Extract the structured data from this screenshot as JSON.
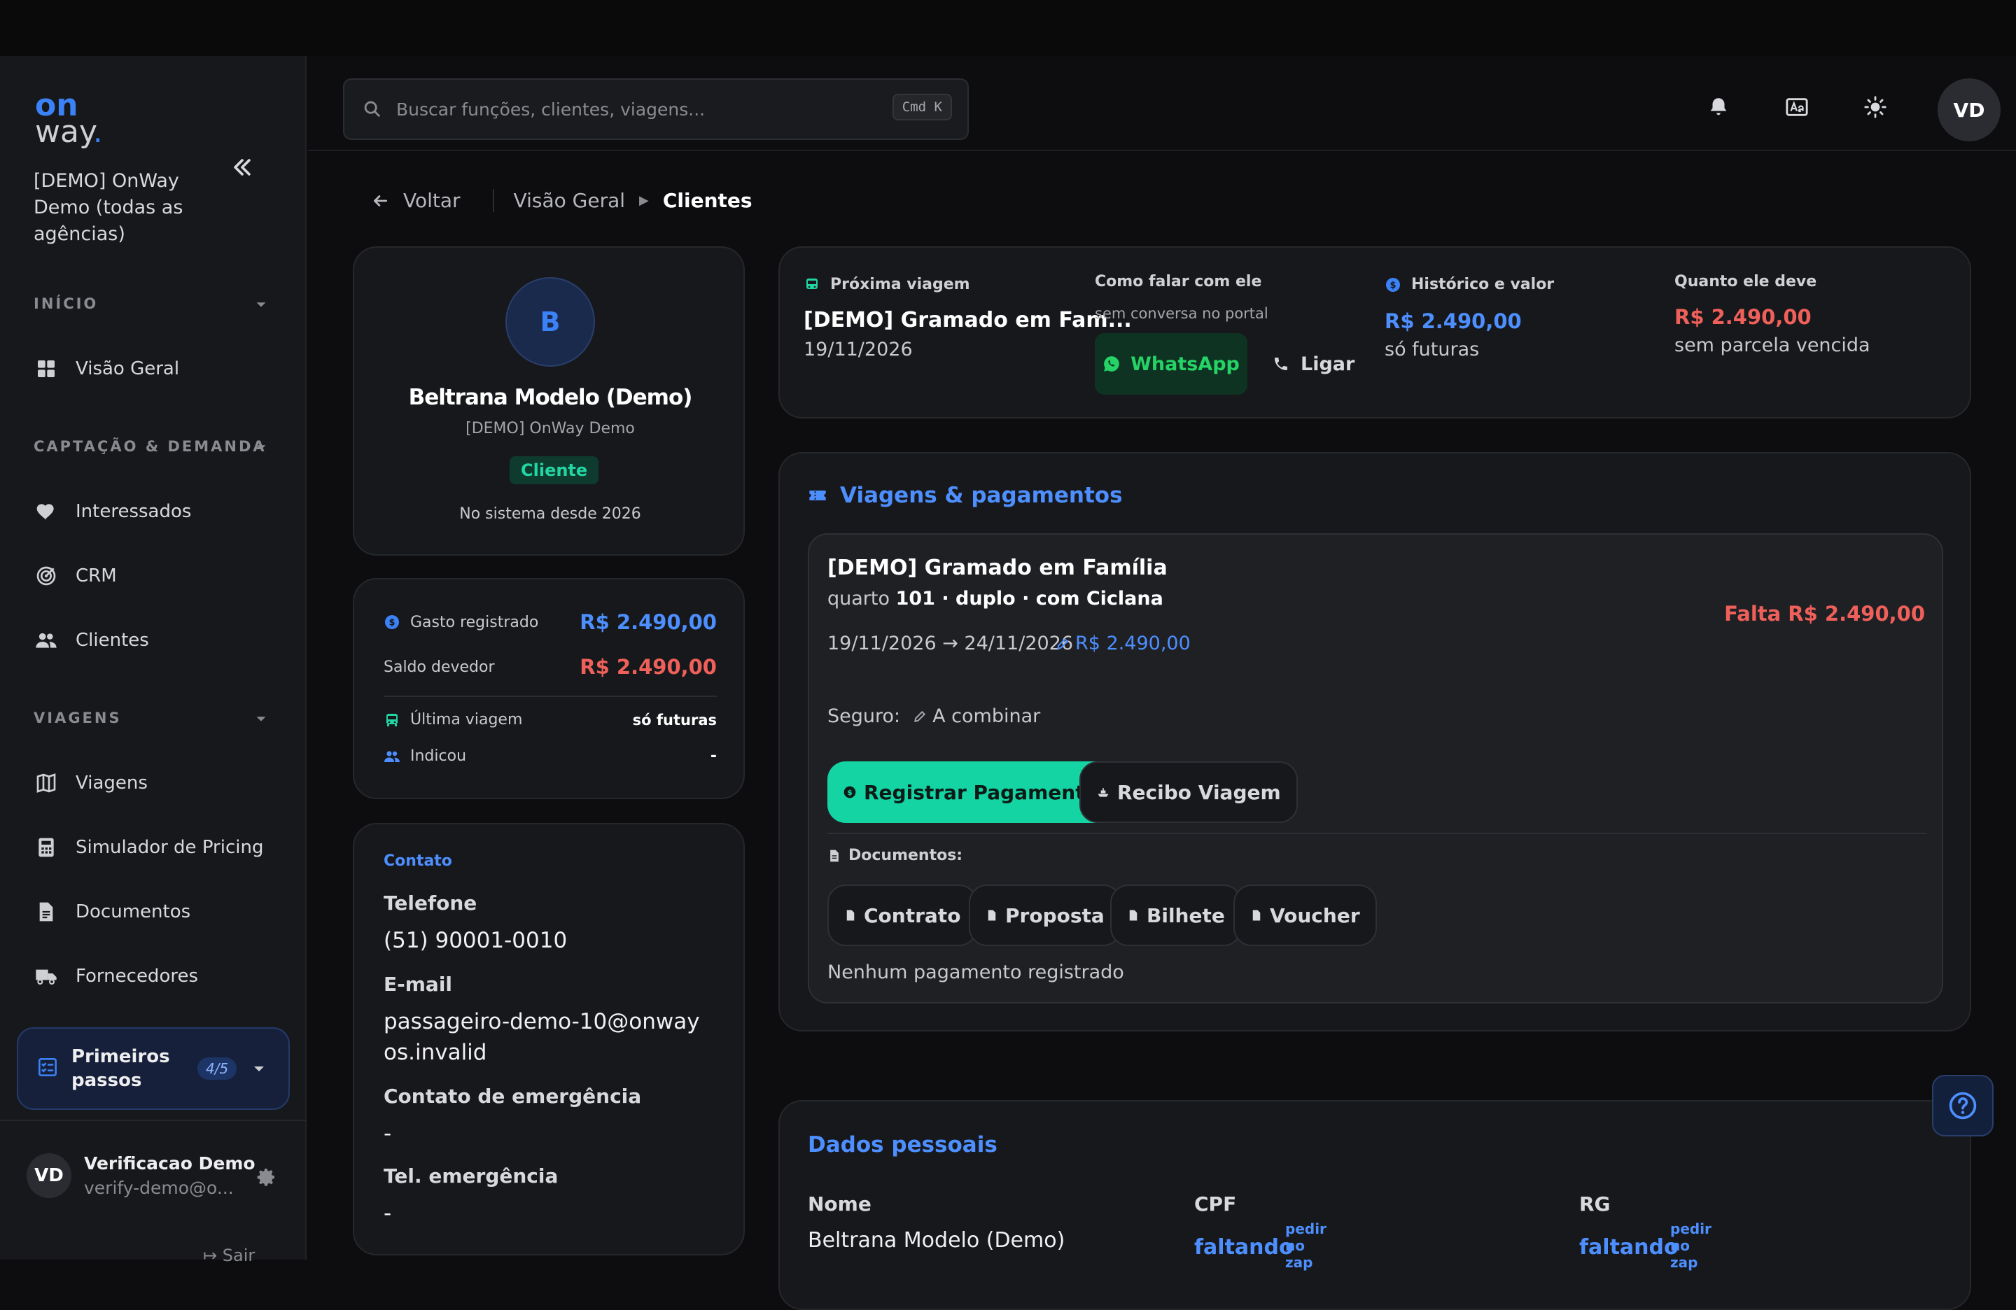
{
  "sidebar": {
    "logo_top": "on",
    "logo_bottom": "way",
    "org_name": "[DEMO] OnWay Demo (todas as agências)",
    "sections": {
      "inicio": "INÍCIO",
      "captacao": "CAPTAÇÃO & DEMANDA",
      "viagens": "VIAGENS"
    },
    "items": {
      "visao_geral": "Visão Geral",
      "interessados": "Interessados",
      "crm": "CRM",
      "clientes": "Clientes",
      "viagens": "Viagens",
      "simulador": "Simulador de Pricing",
      "documentos": "Documentos",
      "fornecedores": "Fornecedores"
    },
    "onboarding": {
      "label": "Primeiros passos",
      "progress": "4/5"
    },
    "user": {
      "initials": "VD",
      "name": "Verificacao Demo",
      "email": "verify-demo@o..."
    },
    "logout": "Sair"
  },
  "topbar": {
    "search_placeholder": "Buscar funções, clientes, viagens...",
    "shortcut": "Cmd K",
    "avatar_initials": "VD"
  },
  "breadcrumb": {
    "back": "Voltar",
    "level1": "Visão Geral",
    "current": "Clientes"
  },
  "profile": {
    "initial": "B",
    "name": "Beltrana Modelo (Demo)",
    "agency": "[DEMO] OnWay Demo",
    "tag": "Cliente",
    "since": "No sistema desde 2026"
  },
  "stats": {
    "spent_label": "Gasto registrado",
    "spent_value": "R$ 2.490,00",
    "due_label": "Saldo devedor",
    "due_value": "R$ 2.490,00",
    "last_trip_label": "Última viagem",
    "last_trip_value": "só futuras",
    "referred_label": "Indicou",
    "referred_value": "-"
  },
  "contact": {
    "title": "Contato",
    "phone_label": "Telefone",
    "phone_value": "(51) 90001-0010",
    "email_label": "E-mail",
    "email_value": "passageiro-demo-10@onwayos.invalid",
    "emergency_label": "Contato de emergência",
    "emergency_value": "-",
    "emergency_phone_label": "Tel. emergência",
    "emergency_phone_value": "-"
  },
  "summary": {
    "next_trip_label": "Próxima viagem",
    "next_trip_name": "[DEMO] Gramado em Fam...",
    "next_trip_date": "19/11/2026",
    "talk_label": "Como falar com ele",
    "talk_note": "sem conversa no portal",
    "whatsapp": "WhatsApp",
    "call": "Ligar",
    "history_label": "Histórico e valor",
    "history_value": "R$ 2.490,00",
    "history_note": "só futuras",
    "owes_label": "Quanto ele deve",
    "owes_value": "R$ 2.490,00",
    "owes_note": "sem parcela vencida"
  },
  "trips": {
    "title": "Viagens & pagamentos",
    "trip_name": "[DEMO] Gramado em Família",
    "room_prefix": "quarto",
    "room_detail": "101 · duplo · com Ciclana",
    "dates": "19/11/2026 → 24/11/2026",
    "price": "R$ 2.490,00",
    "missing": "Falta R$ 2.490,00",
    "insurance_label": "Seguro:",
    "insurance_value": "A combinar",
    "register_payment": "Registrar Pagamento",
    "receipt": "Recibo Viagem",
    "documents_label": "Documentos:",
    "docs": [
      "Contrato",
      "Proposta",
      "Bilhete",
      "Voucher"
    ],
    "no_payments": "Nenhum pagamento registrado"
  },
  "personal": {
    "title": "Dados pessoais",
    "name_label": "Nome",
    "name_value": "Beltrana Modelo (Demo)",
    "cpf_label": "CPF",
    "cpf_value": "faltando",
    "cpf_ask": "pedir no zap",
    "rg_label": "RG",
    "rg_value": "faltando",
    "rg_ask": "pedir no zap"
  },
  "colors": {
    "accent_blue": "#3b82f6",
    "accent_green": "#14d4a4",
    "danger": "#f0605a",
    "whatsapp": "#25d366"
  }
}
